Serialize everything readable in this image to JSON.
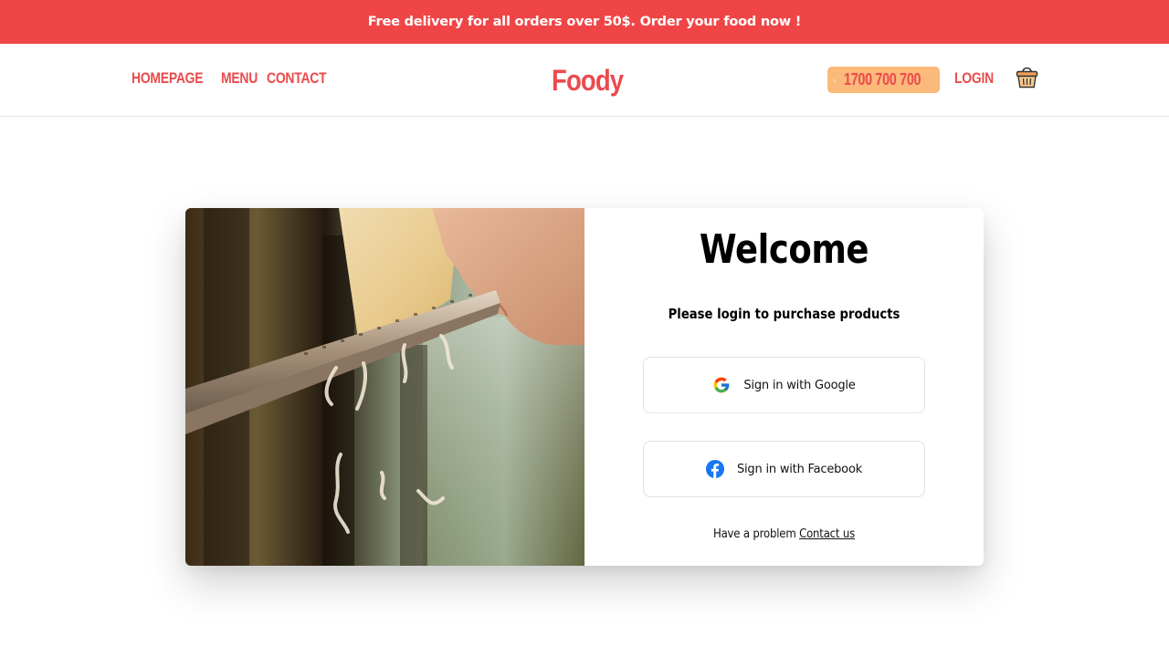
{
  "promo": {
    "text": "Free delivery for all orders over 50$. Order your food now !"
  },
  "nav": {
    "links": [
      {
        "label": "HOMEPAGE"
      },
      {
        "label": "MENU"
      },
      {
        "label": "CONTACT"
      }
    ],
    "logo": "Foody",
    "phone": "1700 700 700",
    "login": "LOGIN"
  },
  "login_card": {
    "title": "Welcome",
    "subtitle": "Please login to purchase products",
    "google_label": "Sign in with Google",
    "facebook_label": "Sign in with Facebook",
    "help_text": "Have a problem",
    "help_link": "Contact us"
  },
  "colors": {
    "brand_red": "#f04547",
    "phone_pill": "#fbb97a",
    "google_blue": "#4285F4",
    "facebook_blue": "#1877F2"
  },
  "icons": [
    "phone-icon",
    "shopping-basket-icon",
    "google-icon",
    "facebook-icon"
  ]
}
